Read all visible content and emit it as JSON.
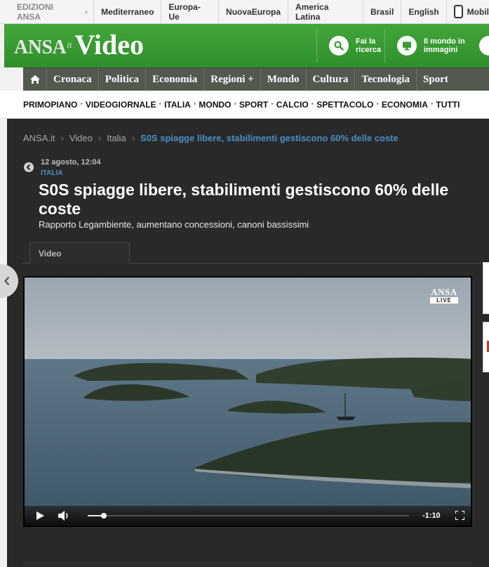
{
  "topbar": {
    "editions_label": "EDIZIONI ANSA",
    "links": [
      "Mediterraneo",
      "Europa-Ue",
      "NuovaEuropa",
      "America Latina",
      "Brasil",
      "English"
    ],
    "mobile_label": "Mobil"
  },
  "header": {
    "logo_ansa": "ANSA",
    "logo_it": "it",
    "logo_video": "Video",
    "btn_search_line1": "Fai la",
    "btn_search_line2": "ricerca",
    "btn_world_line1": "Il mondo in",
    "btn_world_line2": "immagini"
  },
  "catnav": {
    "items": [
      "Cronaca",
      "Politica",
      "Economia",
      "Regioni +",
      "Mondo",
      "Cultura",
      "Tecnologia",
      "Sport"
    ]
  },
  "secnav": {
    "items": [
      "PRIMOPIANO",
      "VIDEOGIORNALE",
      "ITALIA",
      "MONDO",
      "SPORT",
      "CALCIO",
      "SPETTACOLO",
      "ECONOMIA",
      "TUTTI"
    ]
  },
  "breadcrumb": {
    "items": [
      "ANSA.it",
      "Video",
      "Italia"
    ],
    "separator": "›",
    "current": "S0S spiagge libere, stabilimenti gestiscono 60% delle coste"
  },
  "article": {
    "date": "12 agosto, 12:04",
    "section": "ITALIA",
    "title": "S0S spiagge libere, stabilimenti gestiscono 60% delle coste",
    "subtitle": "Rapporto Legambiente, aumentano concessioni, canoni bassissimi",
    "tab_label": "Video"
  },
  "player": {
    "badge_top": "ANSA",
    "badge_bottom": "LIVE",
    "time_remaining": "-1:10",
    "progress_fraction": 0.05
  },
  "colors": {
    "header_green": "#3a9d33",
    "link_blue": "#4a8fc1",
    "catnav_bg": "#53594f"
  }
}
